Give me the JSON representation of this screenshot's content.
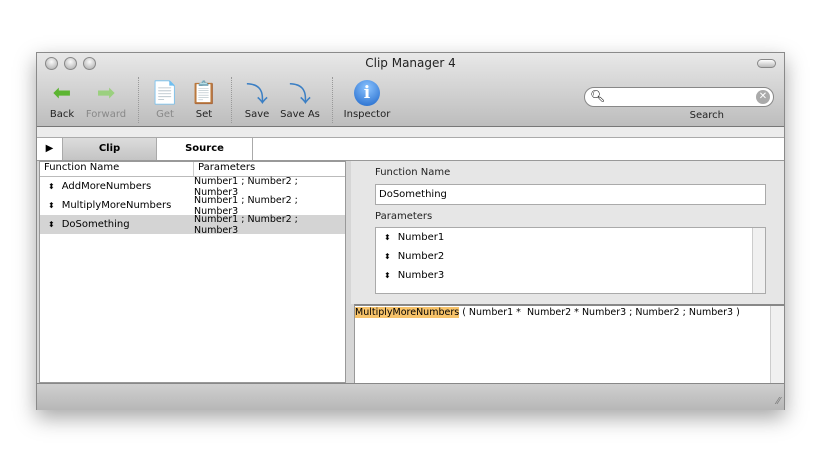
{
  "window": {
    "title": "Clip Manager 4"
  },
  "toolbar": {
    "items": [
      {
        "label": "Back",
        "icon": "back-arrow-icon",
        "enabled": true
      },
      {
        "label": "Forward",
        "icon": "forward-arrow-icon",
        "enabled": false
      },
      {
        "label": "Get",
        "icon": "get-clipboard-icon",
        "enabled": false
      },
      {
        "label": "Set",
        "icon": "set-clipboard-icon",
        "enabled": true
      },
      {
        "label": "Save",
        "icon": "save-drive-icon",
        "enabled": true
      },
      {
        "label": "Save As",
        "icon": "save-as-drive-icon",
        "enabled": true
      },
      {
        "label": "Inspector",
        "icon": "info-icon",
        "enabled": true
      }
    ],
    "search": {
      "label": "Search",
      "value": ""
    }
  },
  "tabs": [
    {
      "label": "Clip",
      "active": true
    },
    {
      "label": "Source",
      "active": false
    }
  ],
  "list": {
    "headers": [
      "Function Name",
      "Parameters"
    ],
    "rows": [
      {
        "name": "AddMoreNumbers",
        "params": "Number1 ; Number2 ; Number3",
        "selected": false
      },
      {
        "name": "MultiplyMoreNumbers",
        "params": "Number1 ; Number2 ; Number3",
        "selected": false
      },
      {
        "name": "DoSomething",
        "params": "Number1 ; Number2 ; Number3",
        "selected": true
      }
    ]
  },
  "detail": {
    "function_name_label": "Function Name",
    "function_name_value": "DoSomething",
    "parameters_label": "Parameters",
    "parameters": [
      "Number1",
      "Number2",
      "Number3"
    ]
  },
  "editor": {
    "highlight": "MultiplyMoreNumbers",
    "rest": " ( Number1 *  Number2 * Number3 ; Number2 ; Number3 )",
    "highlight_color": "#f7c36a"
  }
}
